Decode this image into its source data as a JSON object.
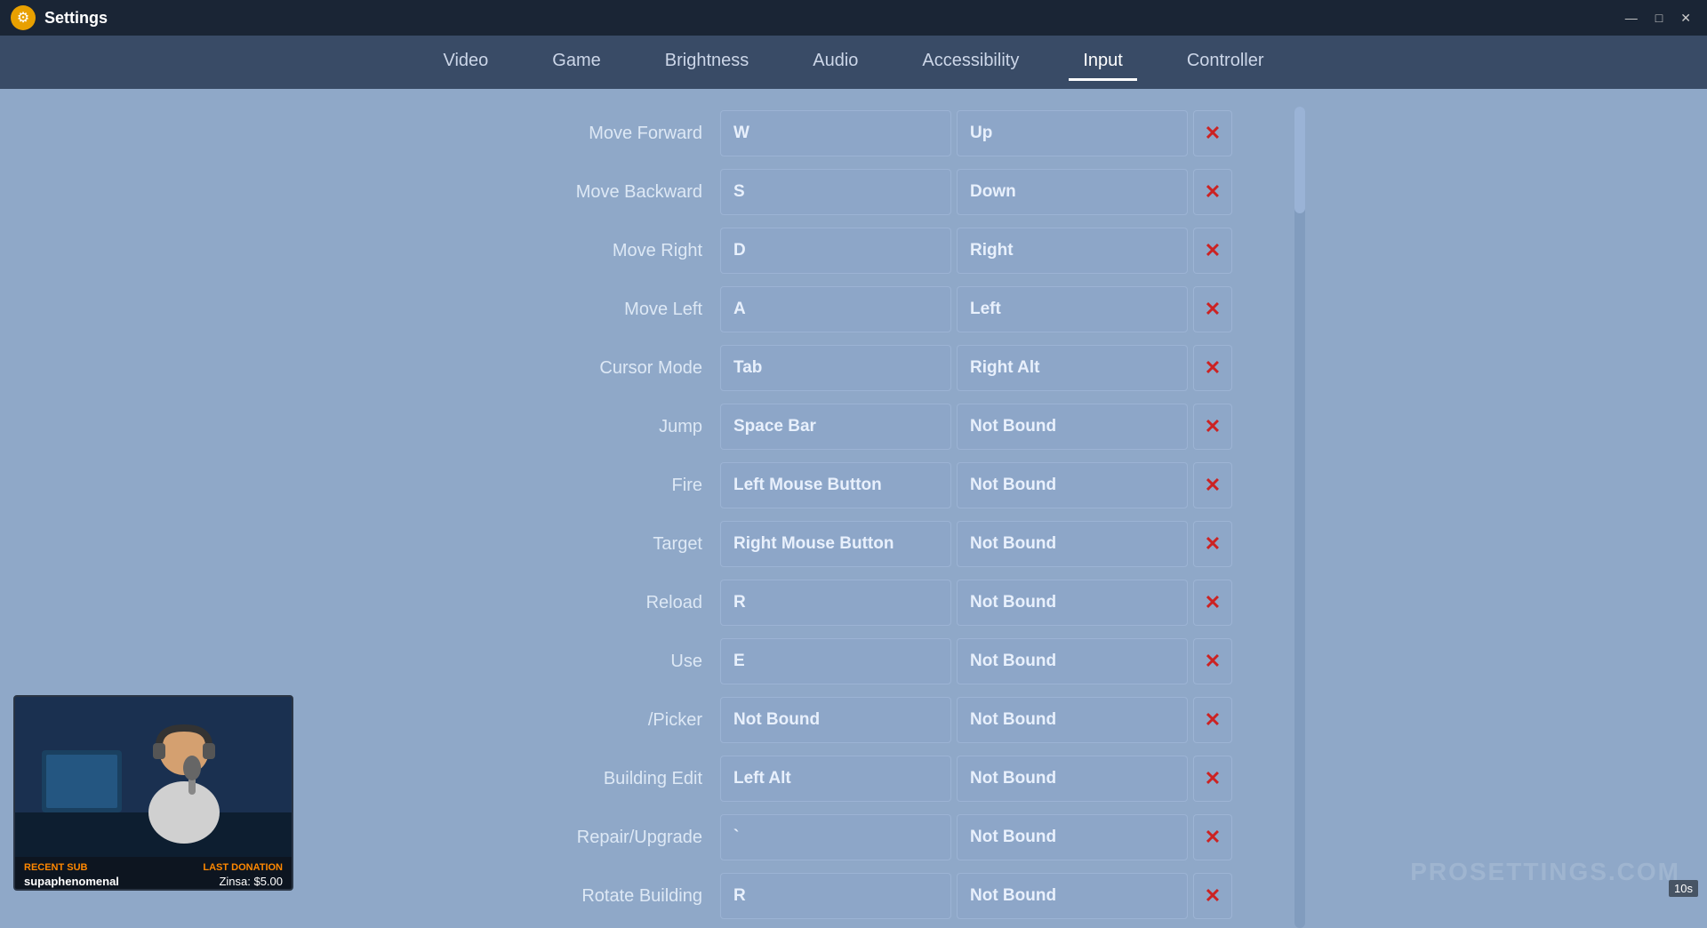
{
  "titleBar": {
    "title": "Settings",
    "gearIcon": "⚙",
    "minimizeBtn": "—",
    "maximizeBtn": "□",
    "closeBtn": "✕"
  },
  "nav": {
    "tabs": [
      {
        "id": "video",
        "label": "Video",
        "active": false
      },
      {
        "id": "game",
        "label": "Game",
        "active": false
      },
      {
        "id": "brightness",
        "label": "Brightness",
        "active": false
      },
      {
        "id": "audio",
        "label": "Audio",
        "active": false
      },
      {
        "id": "accessibility",
        "label": "Accessibility",
        "active": false
      },
      {
        "id": "input",
        "label": "Input",
        "active": true
      },
      {
        "id": "controller",
        "label": "Controller",
        "active": false
      }
    ]
  },
  "keybindings": [
    {
      "action": "Move Forward",
      "primary": "W",
      "secondary": "Up"
    },
    {
      "action": "Move Backward",
      "primary": "S",
      "secondary": "Down"
    },
    {
      "action": "Move Right",
      "primary": "D",
      "secondary": "Right"
    },
    {
      "action": "Move Left",
      "primary": "A",
      "secondary": "Left"
    },
    {
      "action": "Cursor Mode",
      "primary": "Tab",
      "secondary": "Right Alt"
    },
    {
      "action": "Jump",
      "primary": "Space Bar",
      "secondary": "Not Bound"
    },
    {
      "action": "Fire",
      "primary": "Left Mouse Button",
      "secondary": "Not Bound"
    },
    {
      "action": "Target",
      "primary": "Right Mouse Button",
      "secondary": "Not Bound"
    },
    {
      "action": "Reload",
      "primary": "R",
      "secondary": "Not Bound"
    },
    {
      "action": "Use",
      "primary": "E",
      "secondary": "Not Bound"
    },
    {
      "action": "/Picker",
      "primary": "Not Bound",
      "secondary": "Not Bound"
    },
    {
      "action": "Building Edit",
      "primary": "Left Alt",
      "secondary": "Not Bound"
    },
    {
      "action": "Repair/Upgrade",
      "primary": "`",
      "secondary": "Not Bound"
    },
    {
      "action": "Rotate Building",
      "primary": "R",
      "secondary": "Not Bound"
    }
  ],
  "clearBtnSymbol": "✕",
  "webcam": {
    "recentSubLabel": "RECENT SUB",
    "username": "supaphenomenal",
    "lastDonationLabel": "LAST DONATION",
    "donationValue": "Zinsa: $5.00"
  },
  "watermark": "PROSETTINGS.COM",
  "timer": "10s"
}
